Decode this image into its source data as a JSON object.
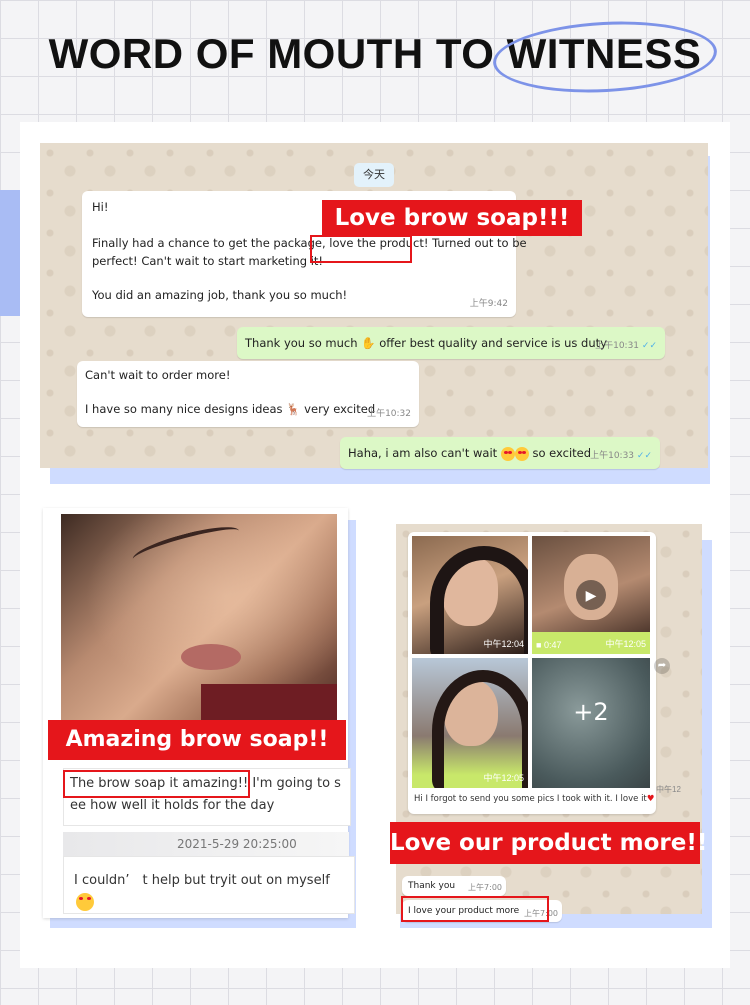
{
  "header": {
    "title_part1": "WORD OF MOUTH TO ",
    "title_part2": "WITNESS"
  },
  "chat1": {
    "date_chip": "今天",
    "msg1": {
      "line_hi": "Hi!",
      "line_a": "Finally had a chance to get the package,",
      "line_highlight": "love the product!",
      "line_b": " Turned out to be",
      "line_c": "perfect! Can't wait to start marketing it!",
      "line_d": "You did an amazing job, thank you so much!",
      "time": "上午9:42"
    },
    "banner": "Love brow soap!!!",
    "msg2": {
      "text_a": "Thank you so much",
      "text_b": " offer best quality and service is us duty",
      "time": "上午10:31"
    },
    "msg3": {
      "line_a": "Can't wait to order more!",
      "line_b": "I have so many nice designs ideas",
      "line_c": " very excited",
      "time": "上午10:32"
    },
    "msg4": {
      "text_a": "Haha, i am also can't wait",
      "text_b": " so excited",
      "time": "上午10:33"
    }
  },
  "left": {
    "banner": "Amazing brow soap!!",
    "comment_highlight": "The brow soap it amazing!!",
    "comment_rest_a": " I'm going to s",
    "comment_rest_b": "ee how well it holds for the day",
    "timestamp": "2021-5-29 20:25:00",
    "reply_line": "I couldn’　t help but tryit out on myself"
  },
  "right": {
    "thumb1_time": "中午12:04",
    "thumb2_duration": "0:47",
    "thumb2_time": "中午12:05",
    "thumb3_time": "中午12:05",
    "thumb4_more": "+2",
    "caption": "Hi I forgot to send you some pics I took with it. I love it",
    "caption_time": "中午12",
    "banner": "Love our product more!!",
    "msg_a": "Thank you",
    "msg_a_time": "上午7:00",
    "msg_b": "I love your product more",
    "msg_b_time": "上午7:00"
  },
  "colors": {
    "accent_red": "#e5161b",
    "accent_blue": "#a9bcf4",
    "chat_green": "#dcf8c6"
  }
}
